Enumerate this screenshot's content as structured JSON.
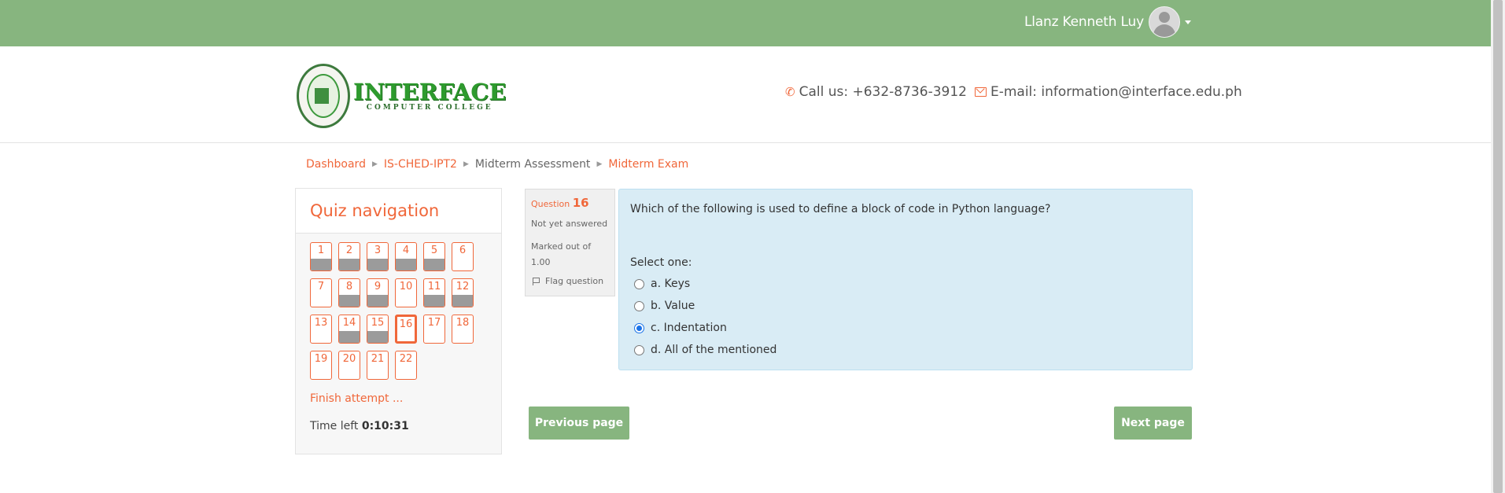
{
  "topbar": {
    "user_name": "Llanz Kenneth Luy"
  },
  "header": {
    "logo_main": "INTERFACE",
    "logo_sub": "COMPUTER COLLEGE",
    "phone": "Call us: +632-8736-3912",
    "email": "E-mail: information@interface.edu.ph"
  },
  "breadcrumb": [
    "Dashboard",
    "IS-CHED-IPT2",
    "Midterm Assessment",
    "Midterm Exam"
  ],
  "quiz_nav": {
    "title": "Quiz navigation",
    "questions": [
      {
        "n": "1",
        "answered": true
      },
      {
        "n": "2",
        "answered": true
      },
      {
        "n": "3",
        "answered": true
      },
      {
        "n": "4",
        "answered": true
      },
      {
        "n": "5",
        "answered": true
      },
      {
        "n": "6",
        "answered": false
      },
      {
        "n": "7",
        "answered": false
      },
      {
        "n": "8",
        "answered": true
      },
      {
        "n": "9",
        "answered": true
      },
      {
        "n": "10",
        "answered": false
      },
      {
        "n": "11",
        "answered": true
      },
      {
        "n": "12",
        "answered": true
      },
      {
        "n": "13",
        "answered": false
      },
      {
        "n": "14",
        "answered": true
      },
      {
        "n": "15",
        "answered": true
      },
      {
        "n": "16",
        "answered": false,
        "current": true
      },
      {
        "n": "17",
        "answered": false
      },
      {
        "n": "18",
        "answered": false
      },
      {
        "n": "19",
        "answered": false
      },
      {
        "n": "20",
        "answered": false
      },
      {
        "n": "21",
        "answered": false
      },
      {
        "n": "22",
        "answered": false
      }
    ],
    "finish_label": "Finish attempt ...",
    "time_label": "Time left",
    "time_value": "0:10:31"
  },
  "question": {
    "label": "Question",
    "number": "16",
    "state": "Not yet answered",
    "marks": "Marked out of 1.00",
    "flag_label": "Flag question",
    "text": "Which of the following is used to define a block of code in Python language?",
    "select_one": "Select one:",
    "options": [
      {
        "label": "a. Keys",
        "checked": false
      },
      {
        "label": "b. Value",
        "checked": false
      },
      {
        "label": "c. Indentation",
        "checked": true
      },
      {
        "label": "d. All of the mentioned",
        "checked": false
      }
    ]
  },
  "buttons": {
    "previous": "Previous page",
    "next": "Next page"
  },
  "colors": {
    "accent": "#f0673a",
    "green": "#87b57f",
    "answer_bg": "#d9ecf5"
  }
}
